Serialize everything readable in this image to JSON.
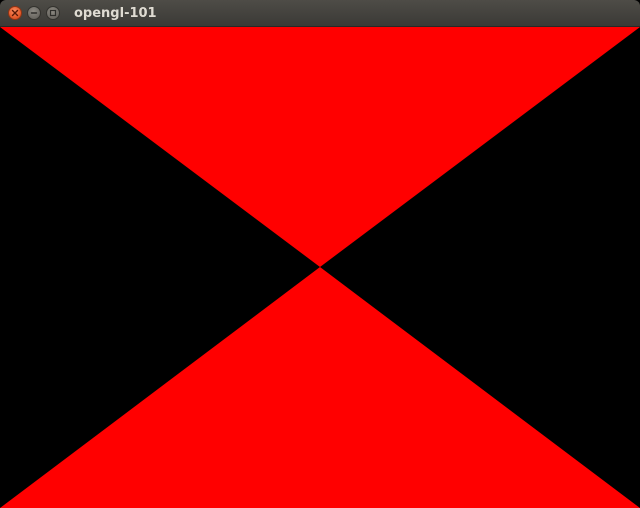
{
  "window": {
    "title": "opengl-101",
    "buttons": [
      "close-icon",
      "minimize-icon",
      "maximize-icon"
    ]
  },
  "scene": {
    "background_color": "#000000",
    "shape_color": "#ff0000",
    "shapes": [
      "triangle-top",
      "triangle-bottom"
    ]
  }
}
